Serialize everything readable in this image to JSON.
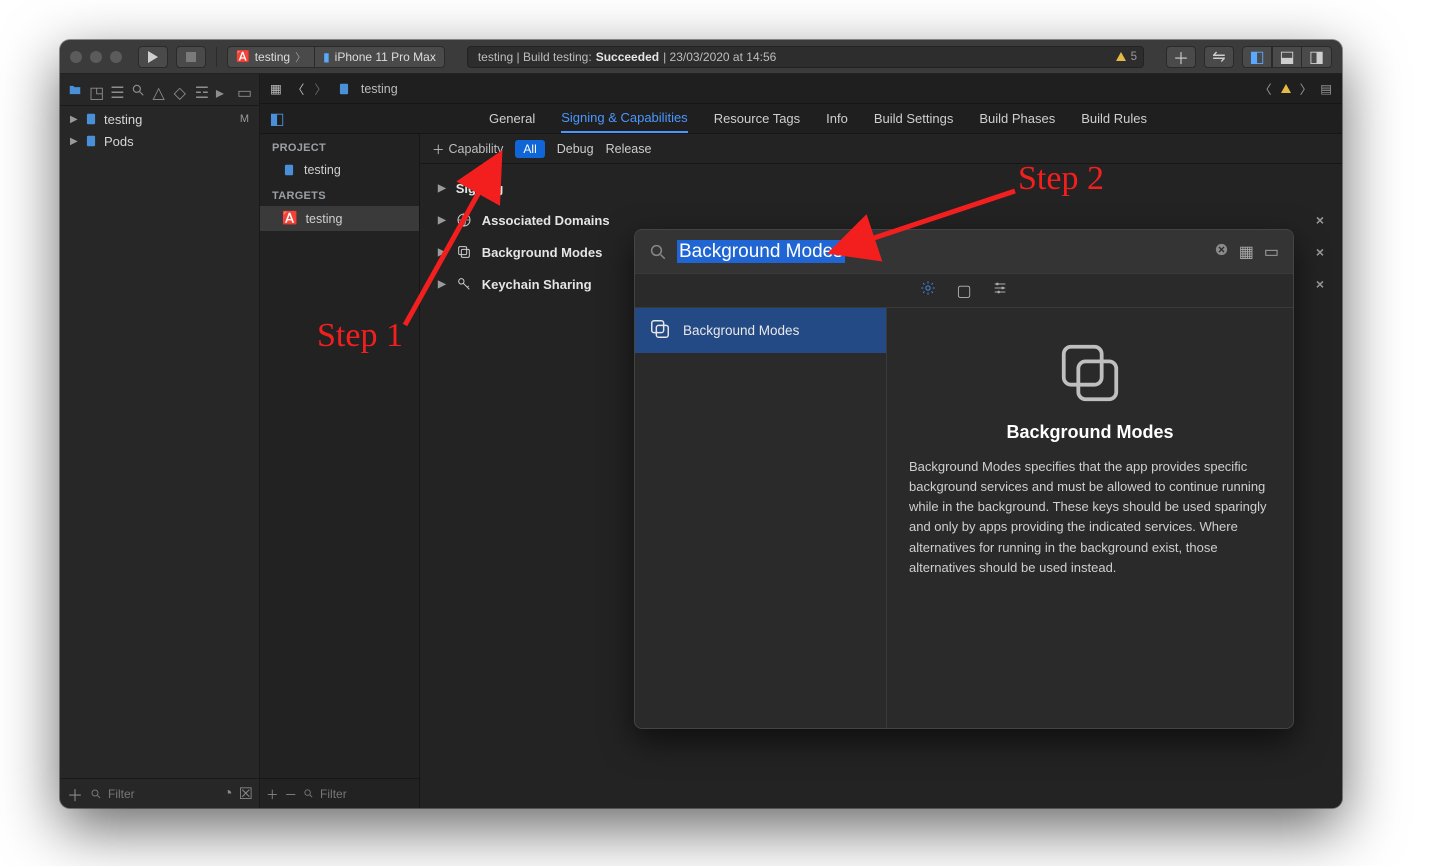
{
  "toolbar": {
    "scheme_target": "testing",
    "scheme_device": "iPhone 11 Pro Max",
    "status_prefix": "testing | Build testing: ",
    "status_strong": "Succeeded",
    "status_suffix": " | 23/03/2020 at 14:56",
    "warn_count": "5"
  },
  "jumpbar": {
    "crumb": "testing"
  },
  "leftnav": {
    "items": [
      {
        "label": "testing",
        "badge": "M"
      },
      {
        "label": "Pods",
        "badge": ""
      }
    ],
    "filter_placeholder": "Filter"
  },
  "outline": {
    "project_hdr": "PROJECT",
    "project_item": "testing",
    "targets_hdr": "TARGETS",
    "target_item": "testing",
    "filter_placeholder": "Filter"
  },
  "tabs": {
    "general": "General",
    "signing": "Signing & Capabilities",
    "resource": "Resource Tags",
    "info": "Info",
    "build_settings": "Build Settings",
    "build_phases": "Build Phases",
    "build_rules": "Build Rules"
  },
  "capbar": {
    "add": "Capability",
    "all": "All",
    "debug": "Debug",
    "release": "Release"
  },
  "sections": {
    "signing": "Signing",
    "assoc": "Associated Domains",
    "bg": "Background Modes",
    "keychain": "Keychain Sharing"
  },
  "popover": {
    "search_value": "Background Modes",
    "list_item": "Background Modes",
    "detail_title": "Background Modes",
    "detail_body": "Background Modes specifies that the app provides specific background services and must be allowed to continue running while in the background. These keys should be used sparingly and only by apps providing the indicated services. Where alternatives for running in the background exist, those alternatives should be used instead."
  },
  "annotations": {
    "step1": "Step 1",
    "step2": "Step 2"
  }
}
